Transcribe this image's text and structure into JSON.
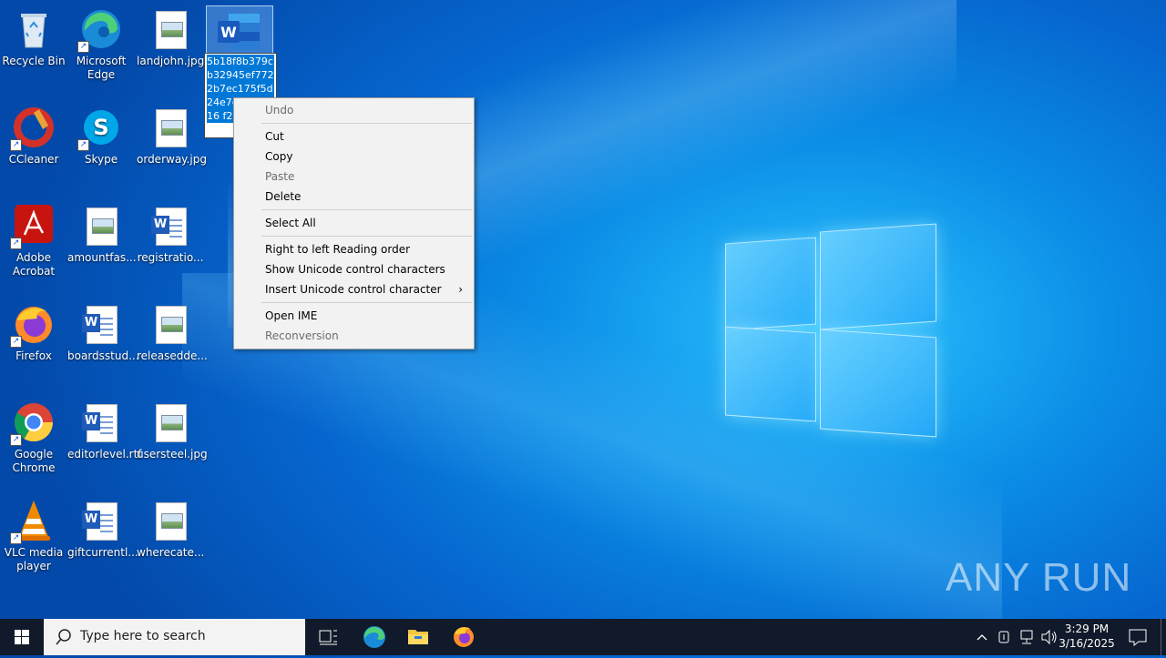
{
  "desktop": {
    "icons": [
      {
        "label": "Recycle Bin"
      },
      {
        "label": "Microsoft Edge"
      },
      {
        "label": "landjohn.jpg"
      },
      {
        "label": "CCleaner"
      },
      {
        "label": "Skype"
      },
      {
        "label": "orderway.jpg"
      },
      {
        "label": "Adobe Acrobat"
      },
      {
        "label": "amountfas..."
      },
      {
        "label": "registratio..."
      },
      {
        "label": "Firefox"
      },
      {
        "label": "boardsstud..."
      },
      {
        "label": "releasedde..."
      },
      {
        "label": "Google Chrome"
      },
      {
        "label": "editorlevel.rtf"
      },
      {
        "label": "usersteel.jpg"
      },
      {
        "label": "VLC media player"
      },
      {
        "label": "giftcurrentl..."
      },
      {
        "label": "wherecate..."
      }
    ],
    "rename_text": "5b18f8b379cb32945ef7722b7ec175f5d24e7c48 3c516 f21"
  },
  "context_menu": {
    "undo": "Undo",
    "cut": "Cut",
    "copy": "Copy",
    "paste": "Paste",
    "delete": "Delete",
    "select_all": "Select All",
    "rtl": "Right to left Reading order",
    "show_unicode": "Show Unicode control characters",
    "insert_unicode": "Insert Unicode control character",
    "open_ime": "Open IME",
    "reconversion": "Reconversion",
    "submenu_arrow": "›"
  },
  "taskbar": {
    "search_placeholder": "Type here to search",
    "time": "3:29 PM",
    "date": "3/16/2025"
  },
  "watermark": "ANY RUN"
}
